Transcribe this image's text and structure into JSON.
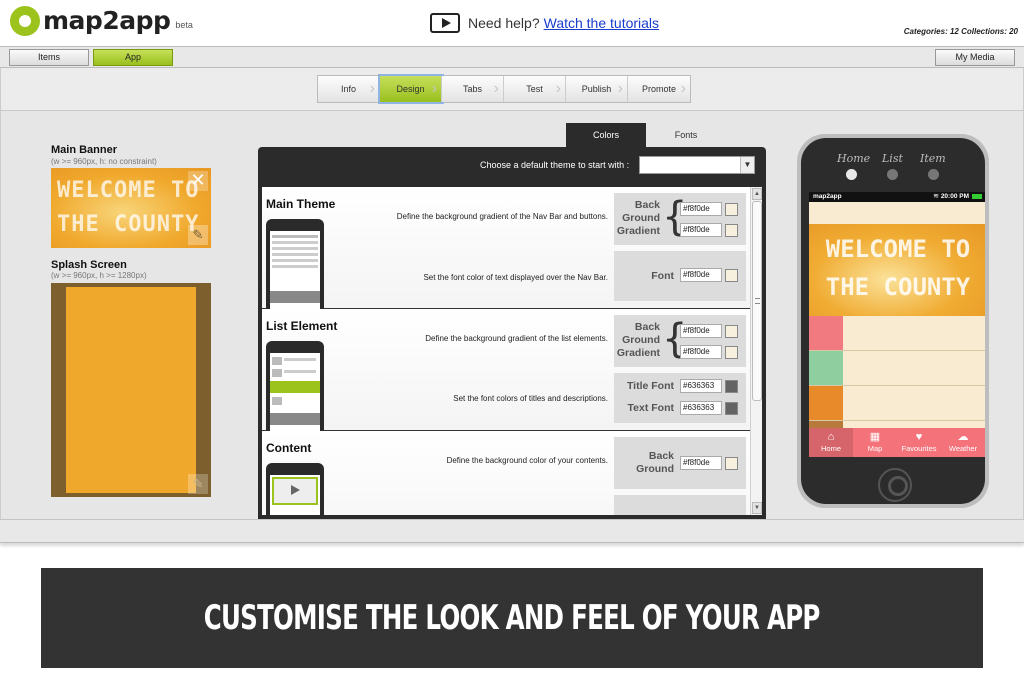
{
  "header": {
    "logo_text": "map2app",
    "logo_beta": "beta",
    "help_text": "Need help?",
    "help_link": "Watch the tutorials",
    "counts": "Categories: 12 Collections: 20"
  },
  "toolbar": {
    "items_label": "Items",
    "app_label": "App",
    "media_label": "My Media"
  },
  "steps": [
    {
      "label": "Info",
      "active": false
    },
    {
      "label": "Design",
      "active": true
    },
    {
      "label": "Tabs",
      "active": false
    },
    {
      "label": "Test",
      "active": false
    },
    {
      "label": "Publish",
      "active": false
    },
    {
      "label": "Promote",
      "active": false
    }
  ],
  "left": {
    "main_banner_title": "Main Banner",
    "main_banner_sub": "(w >= 960px, h: no constraint)",
    "banner_text": "WELCOME TO THE COUNTY",
    "splash_title": "Splash Screen",
    "splash_sub": "(w >= 960px, h >= 1280px)",
    "splash_color": "#f0a82c",
    "splash_border": "#7d5f2d"
  },
  "panel": {
    "tab_colors": "Colors",
    "tab_fonts": "Fonts",
    "theme_label": "Choose a default theme to start with :",
    "theme_value": "",
    "sections": {
      "main_theme": {
        "title": "Main Theme",
        "desc1": "Define the background gradient of the Nav Bar and buttons.",
        "desc2": "Set the font color of text displayed over the Nav Bar.",
        "bg_label": "Back Ground Gradient",
        "bg_hex1": "#f8f0de",
        "bg_hex2": "#f8f0de",
        "font_label": "Font",
        "font_hex": "#f8f0de"
      },
      "list_element": {
        "title": "List Element",
        "desc1": "Define the background gradient of the list elements.",
        "desc2": "Set the font colors of titles and descriptions.",
        "bg_label": "Back Ground Gradient",
        "bg_hex1": "#f8f0de",
        "bg_hex2": "#f8f0de",
        "title_font_label": "Title Font",
        "title_font_hex": "#636363",
        "text_font_label": "Text Font",
        "text_font_hex": "#636363"
      },
      "content": {
        "title": "Content",
        "desc1": "Define the background color of your contents.",
        "bg_label": "Back Ground",
        "bg_hex": "#f8f0de"
      }
    }
  },
  "phone": {
    "nav_home": "Home",
    "nav_list": "List",
    "nav_item": "Item",
    "carrier": "map2app",
    "time": "20:00 PM",
    "banner_text": "WELCOME TO THE COUNTY",
    "tabs": [
      "Home",
      "Map",
      "Favourites",
      "Weather"
    ],
    "tab_color": "#f4727a"
  },
  "caption": "CUSTOMISE THE LOOK AND FEEL OF YOUR APP"
}
